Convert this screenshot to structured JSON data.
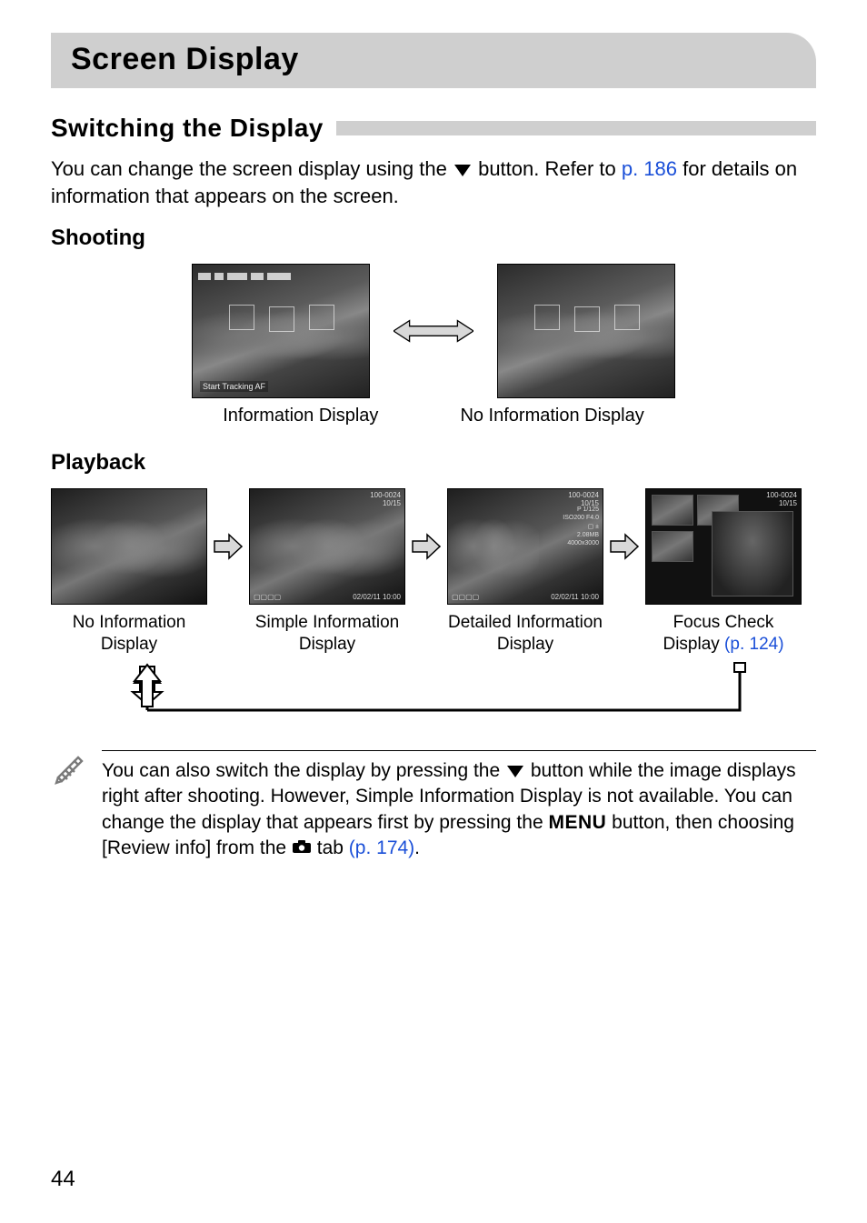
{
  "page": {
    "title": "Screen Display",
    "number": "44"
  },
  "section1": {
    "heading": "Switching the Display",
    "intro": {
      "pre": "You can change the screen display using the ",
      "button_alt": "down",
      "mid": " button. Refer to ",
      "link": "p. 186",
      "post": " for details on information that appears on the screen."
    }
  },
  "shooting": {
    "heading": "Shooting",
    "captions": {
      "left": "Information Display",
      "right": "No Information Display"
    },
    "overlay_label": "Start Tracking AF"
  },
  "playback": {
    "heading": "Playback",
    "items": [
      {
        "line1": "No Information",
        "line2": "Display",
        "link": ""
      },
      {
        "line1": "Simple Information",
        "line2": "Display",
        "link": ""
      },
      {
        "line1": "Detailed Information",
        "line2": "Display",
        "link": ""
      },
      {
        "line1": "Focus Check",
        "line2": "Display ",
        "link": "(p. 124)"
      }
    ]
  },
  "note": {
    "pre": "You can also switch the display by pressing the ",
    "mid1": " button while the image displays right after shooting. However, Simple Information Display is not available. You can change the display that appears first by pressing the ",
    "menu_label": "MENU",
    "mid2": " button, then choosing [Review info] from the ",
    "tab_label": "camera",
    "post": " tab ",
    "link": "(p. 174)",
    "end": "."
  }
}
